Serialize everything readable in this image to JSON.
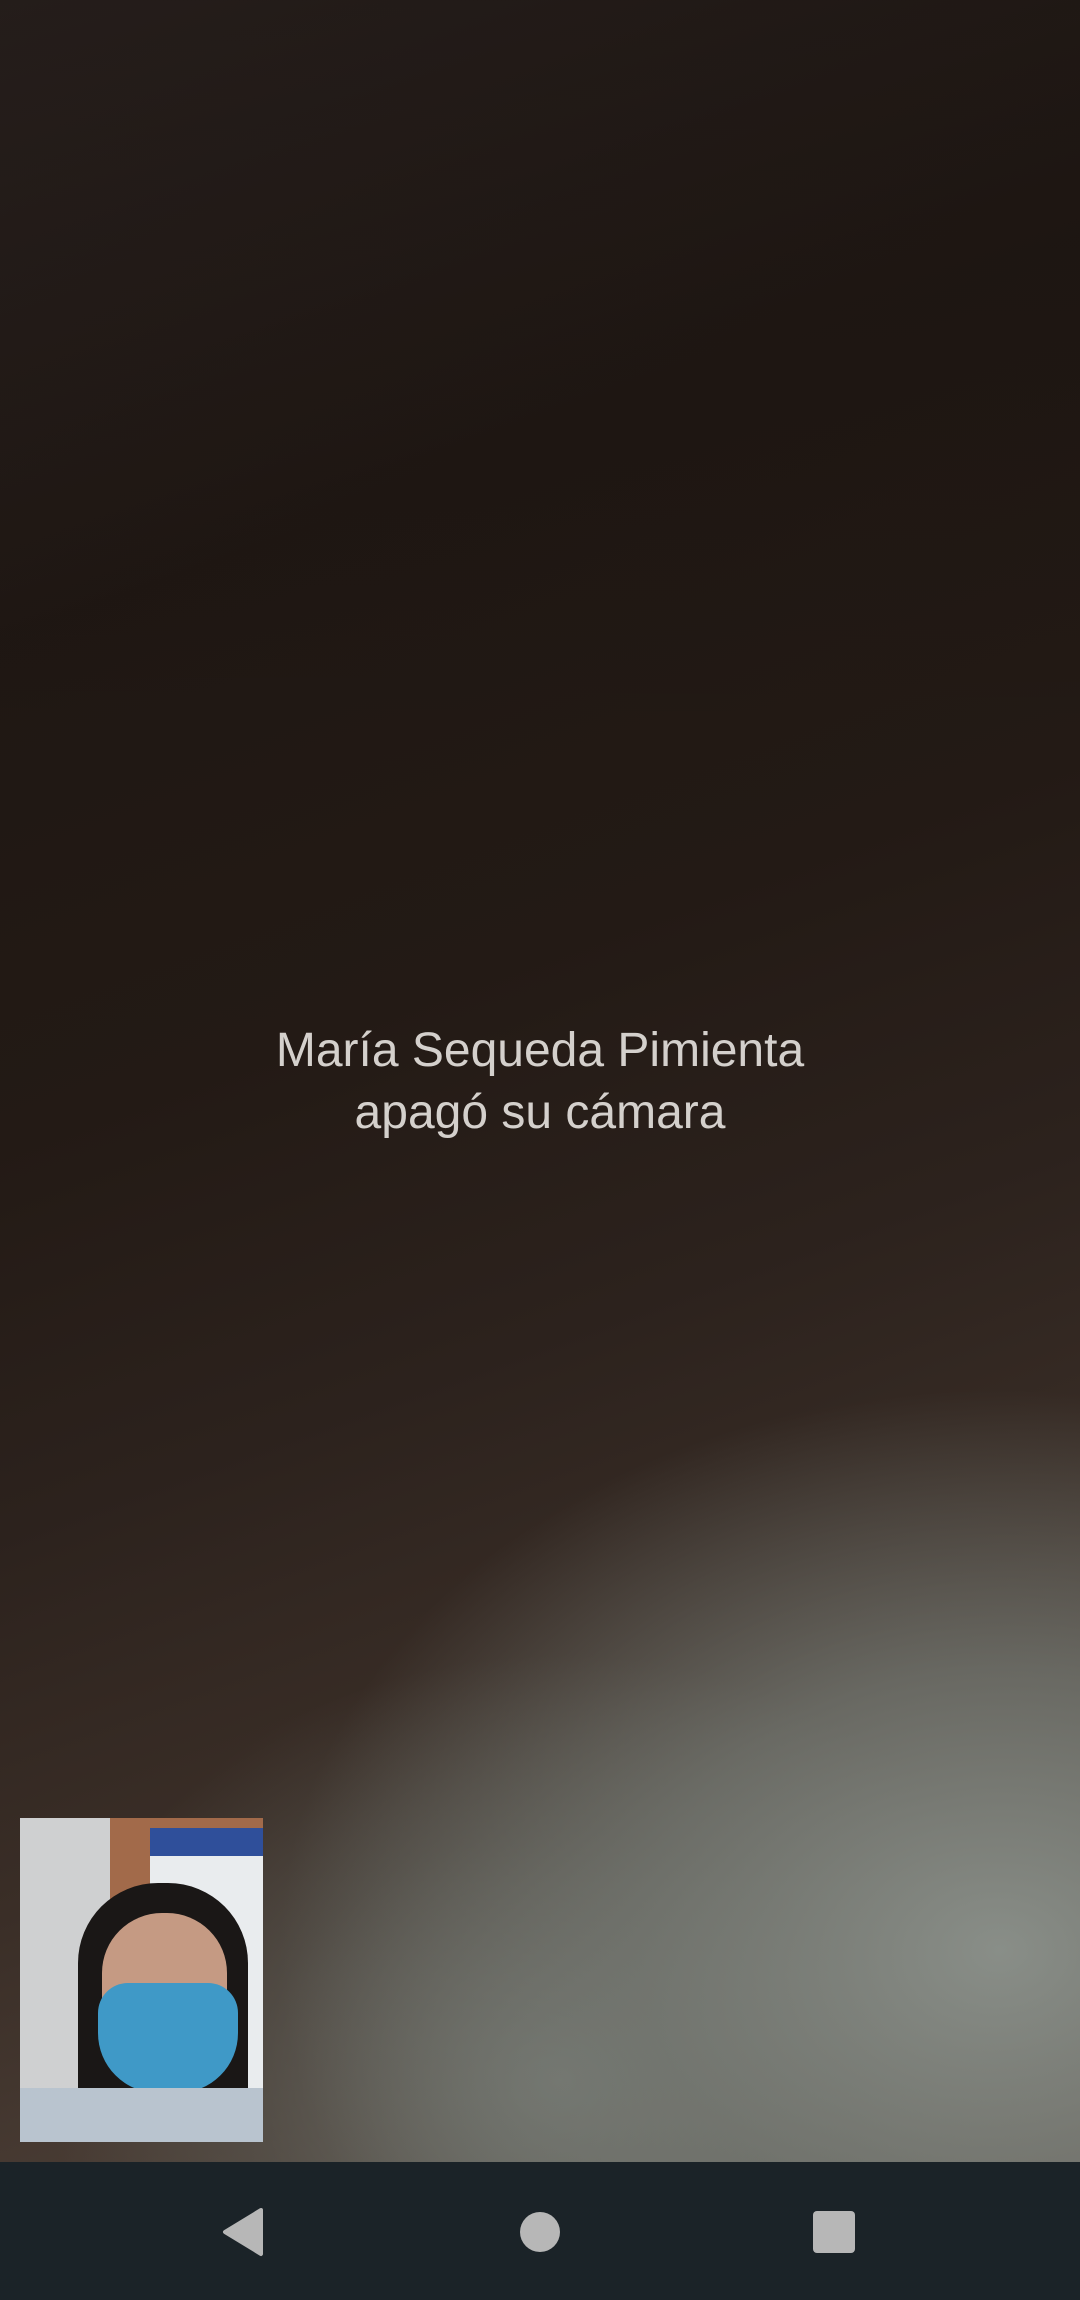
{
  "call": {
    "camera_off_message_line1": "María Sequeda Pimienta",
    "camera_off_message_line2": "apagó su cámara"
  },
  "self_view": {
    "icon": "self-camera-preview"
  },
  "navigation_bar": {
    "back_icon": "back-icon",
    "home_icon": "home-icon",
    "recents_icon": "recents-icon",
    "color": "#b7b7b7"
  }
}
